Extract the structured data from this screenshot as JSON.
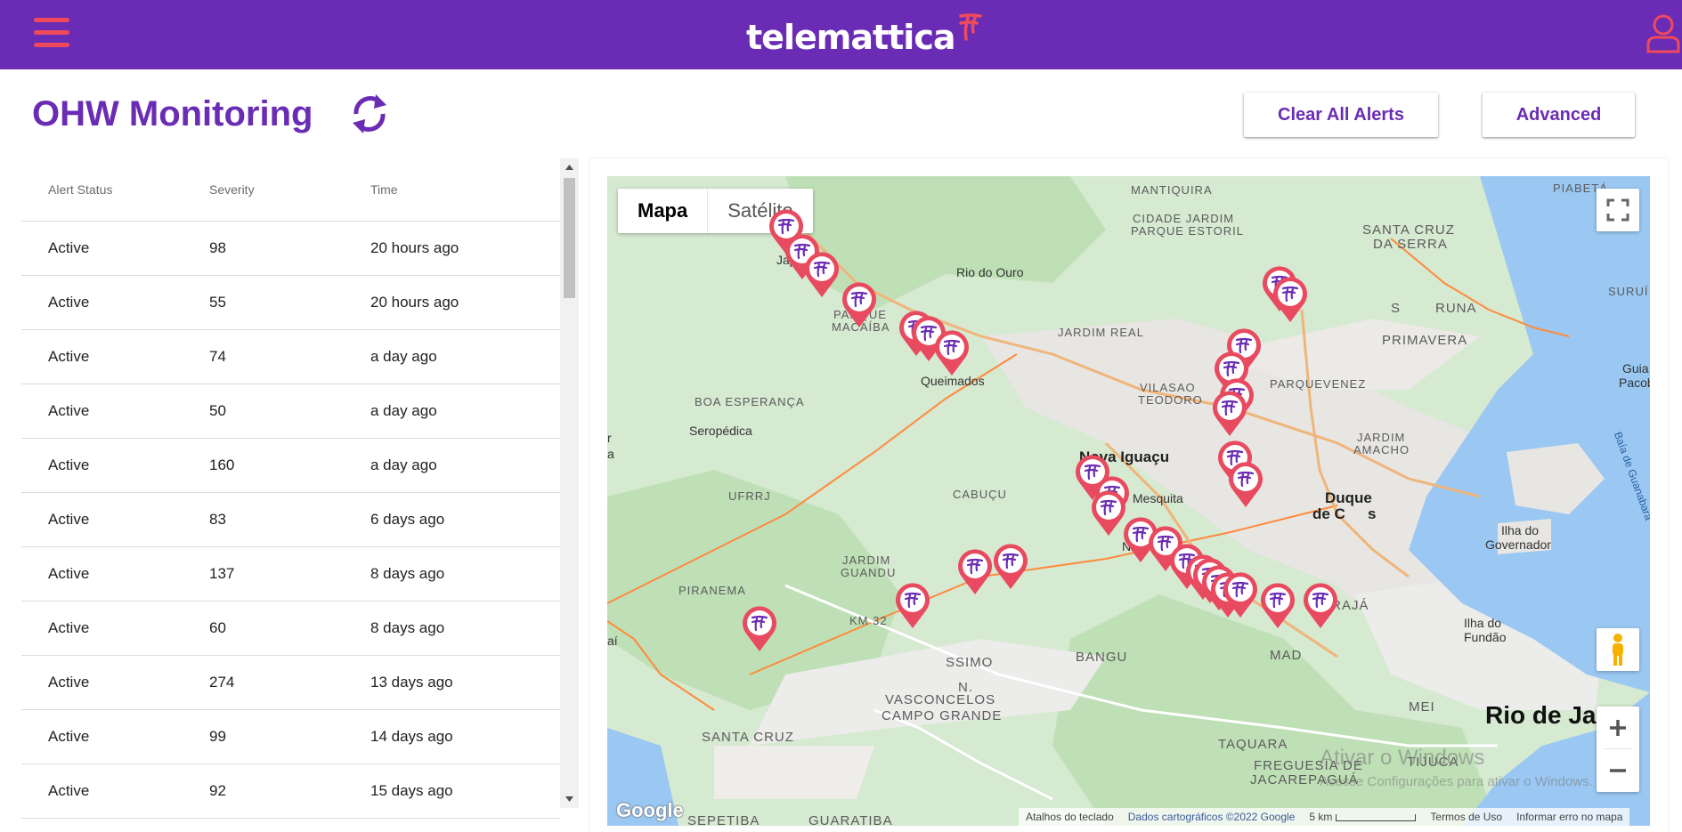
{
  "header": {
    "logo_text": "telemattica",
    "menu_icon": "hamburger-menu-icon",
    "user_icon": "user-icon"
  },
  "page": {
    "title": "OHW Monitoring",
    "refresh_icon": "refresh-icon",
    "buttons": {
      "clear_all": "Clear All Alerts",
      "advanced": "Advanced"
    }
  },
  "table": {
    "columns": [
      "Alert Status",
      "Severity",
      "Time"
    ],
    "rows": [
      {
        "status": "Active",
        "severity": "98",
        "time": "20 hours ago"
      },
      {
        "status": "Active",
        "severity": "55",
        "time": "20 hours ago"
      },
      {
        "status": "Active",
        "severity": "74",
        "time": "a day ago"
      },
      {
        "status": "Active",
        "severity": "50",
        "time": "a day ago"
      },
      {
        "status": "Active",
        "severity": "160",
        "time": "a day ago"
      },
      {
        "status": "Active",
        "severity": "83",
        "time": "6 days ago"
      },
      {
        "status": "Active",
        "severity": "137",
        "time": "8 days ago"
      },
      {
        "status": "Active",
        "severity": "60",
        "time": "8 days ago"
      },
      {
        "status": "Active",
        "severity": "274",
        "time": "13 days ago"
      },
      {
        "status": "Active",
        "severity": "99",
        "time": "14 days ago"
      },
      {
        "status": "Active",
        "severity": "92",
        "time": "15 days ago"
      }
    ]
  },
  "map": {
    "type_control": {
      "map": "Mapa",
      "satellite": "Satélite"
    },
    "places": {
      "mantiquira": "MANTIQUIRA",
      "piabeta": "PIABETÁ",
      "cidade_jardim": "CIDADE JARDIM",
      "parque_estoril": "PARQUE ESTORIL",
      "santa_cruz_serra_1": "SANTA CRUZ",
      "santa_cruz_serra_2": "DA SERRA",
      "japeri": "Japeri",
      "rio_do_ouro": "Rio do Ouro",
      "surui": "SURUÍ",
      "parque_macaiba_1": "PARQUE",
      "parque_macaiba_2": "MACAÍBA",
      "jardim_real": "JARDIM REAL",
      "sao_bento_1": "S",
      "sao_bento_2": "RUNA",
      "primavera": "PRIMAVERA",
      "queimados": "Queimados",
      "vilasao": "VILASAO",
      "teodoro": "TEODORO",
      "parquevenez": "PARQUEVENEZ",
      "guia_pacob_1": "Guia",
      "guia_pacob_2": "Pacob",
      "boa_esperanca": "BOA ESPERANÇA",
      "seropedica": "Seropédica",
      "jardim_camacho_1": "JARDIM",
      "jardim_camacho_2": "AMACHO",
      "nova_iguacu": "Nova Iguaçu",
      "baia": "Baía de Guanabara",
      "ufrrj": "UFRRJ",
      "cabucu": "CABUÇU",
      "mesquita": "Mesquita",
      "duque_1": "Duque",
      "duque_2": "de C",
      "duque_3": "s",
      "ilha_governador_1": "Ilha do",
      "ilha_governador_2": "Governador",
      "nilopolis": "Nilóp",
      "jardim_guandu_1": "JARDIM",
      "jardim_guandu_2": "GUANDU",
      "piranema": "PIRANEMA",
      "iraja": "IRAJÁ",
      "km32": "KM 32",
      "ilha_fundao_1": "Ilha do",
      "ilha_fundao_2": "Fundão",
      "santissimo": "SSIMO",
      "bangu": "BANGU",
      "madureira": "MAD",
      "vasconcelos": "VASCONCELOS",
      "santa_cruz": "SANTA CRUZ",
      "campo_grande": "CAMPO GRANDE",
      "meier": "MEI",
      "rio_de_janeiro": "Rio de Jan",
      "taquara": "TAQUARA",
      "tijuca": "TIJUCA",
      "freguesia_1": "FREGUESIA DE",
      "freguesia_2": "JACAREPAGUÁ",
      "sepetiba": "SEPETIBA",
      "guaratiba": "GUARATIBA",
      "edge_left_1": "r",
      "edge_left_2": "a",
      "edge_left_3": "aí",
      "vasc_n": "N."
    },
    "attribution": {
      "google": "Google",
      "shortcuts": "Atalhos do teclado",
      "data": "Dados cartográficos ©2022 Google",
      "scale": "5 km",
      "terms": "Termos de Uso",
      "report": "Informar erro no mapa"
    },
    "watermark": {
      "title": "Ativar o Windows",
      "subtitle": "Acesse Configurações para ativar o Windows."
    },
    "colors": {
      "marker": "#e84a5f",
      "marker_glyph": "#6a2cb4",
      "water": "#9ac8f2",
      "land": "#d6e9d1",
      "road": "#f0b57a"
    }
  },
  "colors": {
    "brand": "#6a2cb4",
    "accent": "#ef4a5c"
  }
}
